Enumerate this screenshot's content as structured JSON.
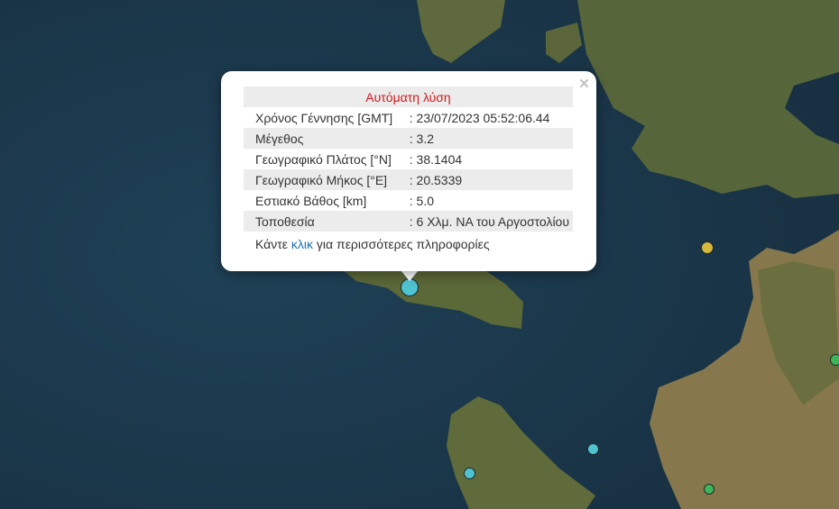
{
  "map": {
    "colors": {
      "sea": "#1d3a4e",
      "land": "#5f6b3c",
      "land_dry": "#8a7a50"
    }
  },
  "markers": [
    {
      "name": "selected",
      "color": "#4fc3d0"
    },
    {
      "name": "yellow",
      "color": "#d6b83a"
    },
    {
      "name": "cyan-1",
      "color": "#4fc3d0"
    },
    {
      "name": "cyan-2",
      "color": "#4fc3d0"
    },
    {
      "name": "green-1",
      "color": "#3db55a"
    },
    {
      "name": "green-2",
      "color": "#3db55a"
    }
  ],
  "popup": {
    "title": "Αυτόματη λύση",
    "close_label": "×",
    "rows": [
      {
        "label": "Χρόνος Γέννησης [GMT]",
        "value": ": 23/07/2023 05:52:06.44"
      },
      {
        "label": "Μέγεθος",
        "value": ": 3.2"
      },
      {
        "label": "Γεωγραφικό Πλάτος [°N]",
        "value": ": 38.1404"
      },
      {
        "label": "Γεωγραφικό Μήκος [°E]",
        "value": ": 20.5339"
      },
      {
        "label": "Εστιακό Βάθος [km]",
        "value": ": 5.0"
      },
      {
        "label": "Τοποθεσία",
        "value": ": 6 Χλμ. ΝΑ του Αργοστολίου"
      }
    ],
    "more_prefix": "Κάντε ",
    "more_link": "κλικ",
    "more_suffix": " για περισσότερες πληροφορίες"
  }
}
